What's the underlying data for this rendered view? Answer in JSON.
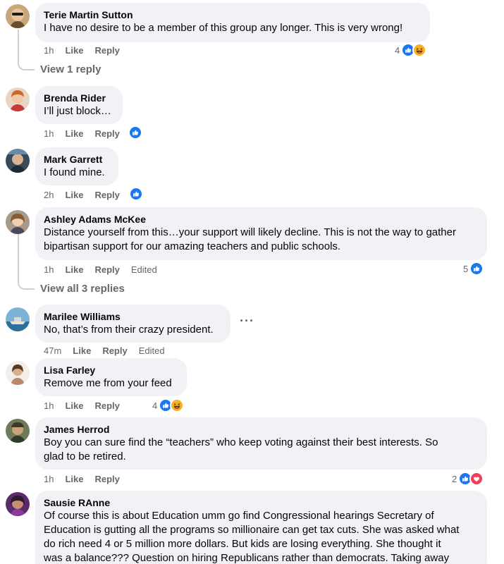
{
  "comments": [
    {
      "author": "Terie Martin Sutton",
      "text": "I have no desire to be a member of this group any longer. This is very wrong!",
      "time": "1h",
      "like": "Like",
      "reply": "Reply",
      "reaction_count": "4"
    },
    {
      "author": "Brenda Rider",
      "text": "I’ll just block…",
      "time": "1h",
      "like": "Like",
      "reply": "Reply"
    },
    {
      "author": "Mark Garrett",
      "text": "I found mine.",
      "time": "2h",
      "like": "Like",
      "reply": "Reply"
    },
    {
      "author": "Ashley Adams McKee",
      "text1": "Distance yourself from this…your support will likely decline. This is not the way to gather",
      "text2": "bipartisan support for our amazing teachers and public schools.",
      "time": "1h",
      "like": "Like",
      "reply": "Reply",
      "edited": "Edited",
      "reaction_count": "5"
    },
    {
      "author": "Marilee Williams",
      "text": "No, that’s from their crazy president.",
      "time": "47m",
      "like": "Like",
      "reply": "Reply",
      "edited": "Edited",
      "more": "···"
    },
    {
      "author": "Lisa Farley",
      "text": "Remove me from your feed",
      "time": "1h",
      "like": "Like",
      "reply": "Reply",
      "reaction_count": "4"
    },
    {
      "author": "James Herrod",
      "text1": "Boy you can sure find the “teachers” who keep voting against their best interests. So",
      "text2": "glad to be retired.",
      "time": "1h",
      "like": "Like",
      "reply": "Reply",
      "reaction_count": "2"
    },
    {
      "author": "Sausie RAnne",
      "lines": [
        "Of course this is about Education umm go find Congressional hearings Secretary of",
        "Education is gutting all the programs so millionaire can get tax cuts. She was asked what",
        "do rich need 4 or 5 million more dollars. But kids are losing everything. She thought it",
        "was a balance??? Question on hiring Republicans rather than democrats. Taking away"
      ]
    }
  ],
  "view_replies": [
    "View 1 reply",
    "View all 3 replies"
  ],
  "colors": {
    "bubble": "#f0f2f5",
    "like_blue": "#1877f2",
    "love_red": "#f33e58",
    "haha_yellow": "#f7b125",
    "meta_gray": "#65676b"
  },
  "icons": {
    "like": "like-reaction-icon",
    "haha": "haha-reaction-icon",
    "love": "love-reaction-icon"
  }
}
